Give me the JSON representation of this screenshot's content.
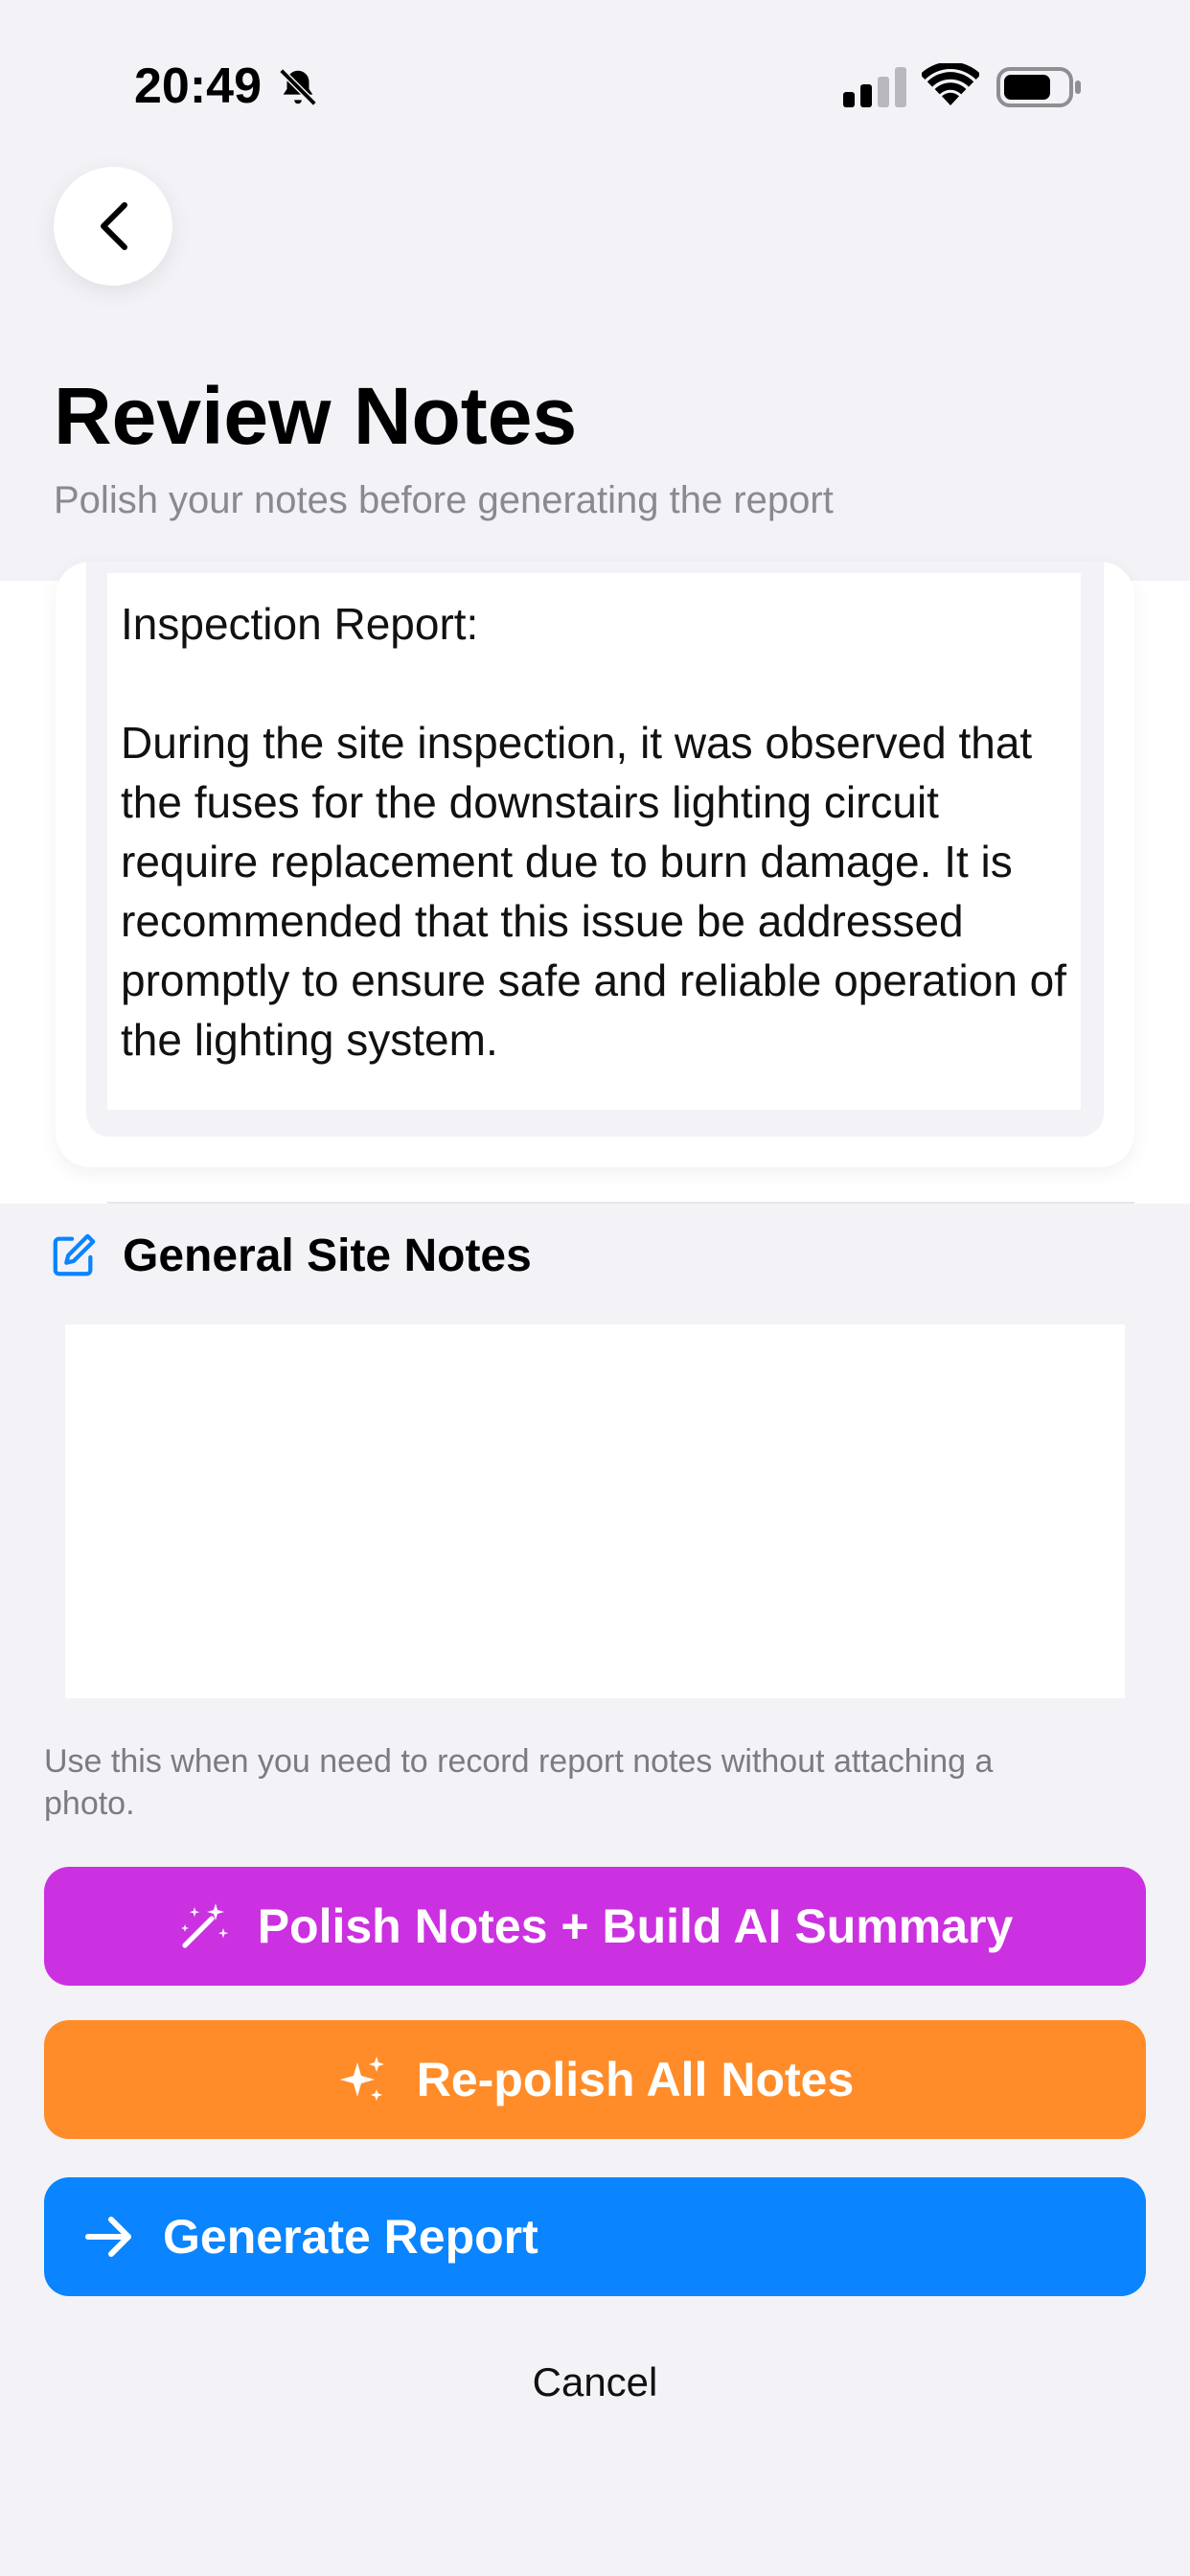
{
  "status_bar": {
    "time": "20:49",
    "icons": [
      "bell-slash-icon",
      "signal-icon",
      "wifi-icon",
      "battery-icon"
    ]
  },
  "header": {
    "back_icon": "chevron-left-icon",
    "title": "Review Notes",
    "subtitle": "Polish your notes before generating the report"
  },
  "note_card": {
    "text": "Inspection Report:\n\nDuring the site inspection, it was observed that the fuses for the downstairs lighting circuit require replacement due to burn damage. It is recommended that this issue be addressed promptly to ensure safe and reliable operation of the lighting system."
  },
  "general_site_notes": {
    "icon": "square-pencil-icon",
    "title": "General Site Notes",
    "value": "",
    "helper": "Use this when you need to record report notes without attaching a photo."
  },
  "buttons": {
    "polish": {
      "label": "Polish Notes + Build AI Summary",
      "icon": "magic-wand-icon",
      "color": "#cb31e0"
    },
    "repolish": {
      "label": "Re-polish All Notes",
      "icon": "sparkles-icon",
      "color": "#ff8c29"
    },
    "generate": {
      "label": "Generate Report",
      "icon": "arrow-right-icon",
      "color": "#0a84ff"
    },
    "cancel": {
      "label": "Cancel"
    }
  }
}
